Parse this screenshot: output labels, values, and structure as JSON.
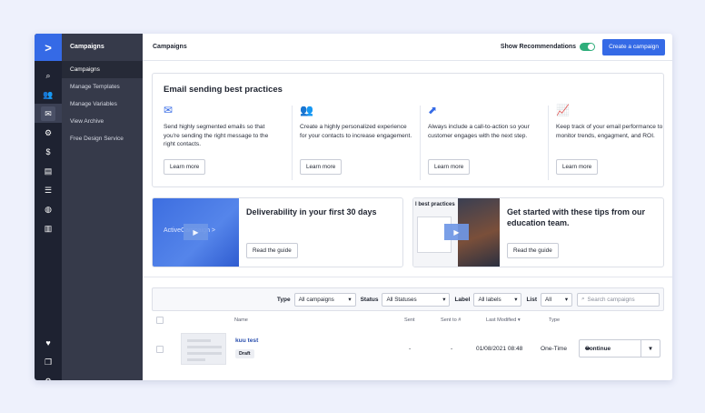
{
  "rail": {
    "logo": ">",
    "icons": [
      {
        "name": "search-icon",
        "glyph": "⌕"
      },
      {
        "name": "contacts-icon",
        "glyph": "👥"
      },
      {
        "name": "campaigns-icon",
        "glyph": "✉"
      },
      {
        "name": "automations-icon",
        "glyph": "⚙"
      },
      {
        "name": "deals-icon",
        "glyph": "$"
      },
      {
        "name": "conversations-icon",
        "glyph": "▤"
      },
      {
        "name": "lists-icon",
        "glyph": "☰"
      },
      {
        "name": "website-icon",
        "glyph": "◍"
      },
      {
        "name": "reports-icon",
        "glyph": "▥"
      }
    ],
    "bottom_icons": [
      {
        "name": "heart-icon",
        "glyph": "♥"
      },
      {
        "name": "pages-icon",
        "glyph": "❐"
      },
      {
        "name": "settings-icon",
        "glyph": "⚙"
      }
    ]
  },
  "sidebar": {
    "title": "Campaigns",
    "items": [
      "Campaigns",
      "Manage Templates",
      "Manage Variables",
      "View Archive",
      "Free Design Service"
    ]
  },
  "header": {
    "title": "Campaigns",
    "toggle_label": "Show Recommendations",
    "create_button": "Create a campaign"
  },
  "best_practices": {
    "title": "Email sending best practices",
    "tips": [
      {
        "icon": "envelope-check-icon",
        "glyph": "✉",
        "text": "Send highly segmented emails so that you're sending the right message to the right contacts.",
        "button": "Learn more"
      },
      {
        "icon": "people-icon",
        "glyph": "👥",
        "text": "Create a highly personalized experience for your contacts to increase engagement.",
        "button": "Learn more"
      },
      {
        "icon": "cursor-icon",
        "glyph": "⬈",
        "text": "Always include a call-to-action so your customer engages with the next step.",
        "button": "Learn more"
      },
      {
        "icon": "trend-chart-icon",
        "glyph": "📈",
        "text": "Keep track of your email performance to monitor trends, engagment, and ROI.",
        "button": "Learn more"
      }
    ]
  },
  "cards": [
    {
      "title": "Deliverability in your first 30 days",
      "button": "Read the guide",
      "thumb_text": "ActiveCampaign >"
    },
    {
      "title": "Get started with these tips from our education team.",
      "button": "Read the guide",
      "thumb_text": "l best practices"
    }
  ],
  "filters": {
    "type_label": "Type",
    "type_value": "All campaigns",
    "status_label": "Status",
    "status_value": "All Statuses",
    "label_label": "Label",
    "label_value": "All labels",
    "list_label": "List",
    "list_value": "All",
    "search_placeholder": "Search campaigns"
  },
  "table": {
    "columns": [
      "Name",
      "Sent",
      "Sent to #",
      "Last Modified",
      "Type"
    ],
    "sort_arrow": "▾",
    "rows": [
      {
        "name": "kuu test",
        "status": "Draft",
        "sent": "-",
        "sent_to": "-",
        "last_modified": "01/08/2021 08:48",
        "type": "One-Time",
        "action": "Continue"
      }
    ]
  }
}
